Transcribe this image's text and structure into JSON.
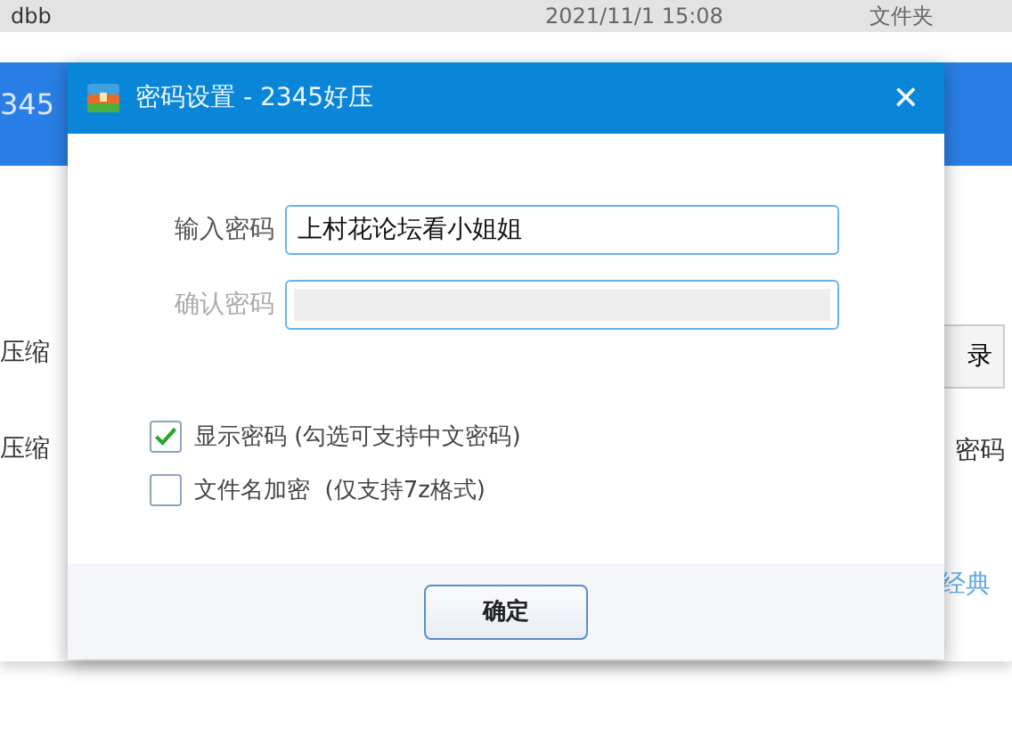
{
  "file_row": {
    "name": "dbb",
    "date": "2021/11/1 15:08",
    "type": "文件夹"
  },
  "background_window": {
    "title": "345",
    "left_labels": [
      "压缩",
      "压缩"
    ],
    "right_button": "录",
    "right_label": "密码",
    "link": "经典"
  },
  "dialog": {
    "title": "密码设置 - 2345好压",
    "close": "✕",
    "fields": [
      {
        "label": "输入密码",
        "value": "上村花论坛看小姐姐",
        "disabled": false
      },
      {
        "label": "确认密码",
        "disabled": true
      }
    ],
    "options": [
      {
        "label": "显示密码 (勾选可支持中文密码)",
        "checked": true
      },
      {
        "label": "文件名加密  (仅支持7z格式)",
        "checked": false
      }
    ],
    "button": "确定"
  }
}
